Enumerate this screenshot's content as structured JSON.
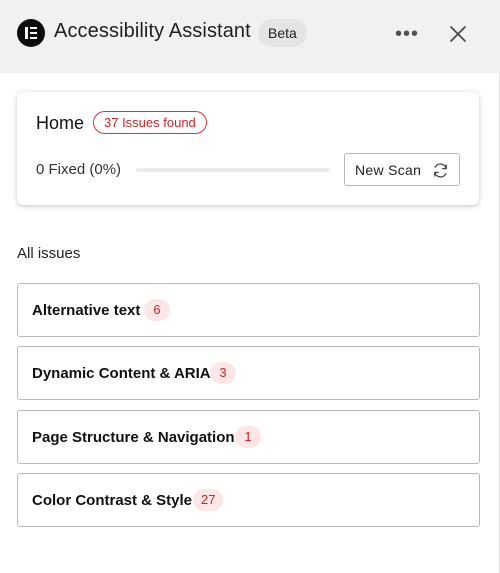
{
  "header": {
    "title": "Accessibility Assistant",
    "beta_label": "Beta",
    "more_icon": "ellipsis-icon",
    "close_icon": "close-icon",
    "logo_icon": "elementor-logo-icon"
  },
  "summary": {
    "page_title": "Home",
    "issues_badge": "37 Issues found",
    "fixed_text": "0 Fixed (0%)",
    "fixed_percent": 0,
    "scan_button_label": "New Scan",
    "scan_icon": "refresh-icon"
  },
  "issues": {
    "section_title": "All issues",
    "items": [
      {
        "label": "Alternative text",
        "count": "6"
      },
      {
        "label": "Dynamic Content & ARIA",
        "count": "3"
      },
      {
        "label": "Page Structure & Navigation",
        "count": "1"
      },
      {
        "label": "Color Contrast & Style",
        "count": "27"
      }
    ]
  },
  "colors": {
    "accent_red": "#c62828",
    "badge_bg": "#fde6e6",
    "header_bg": "#f1f1f1"
  }
}
